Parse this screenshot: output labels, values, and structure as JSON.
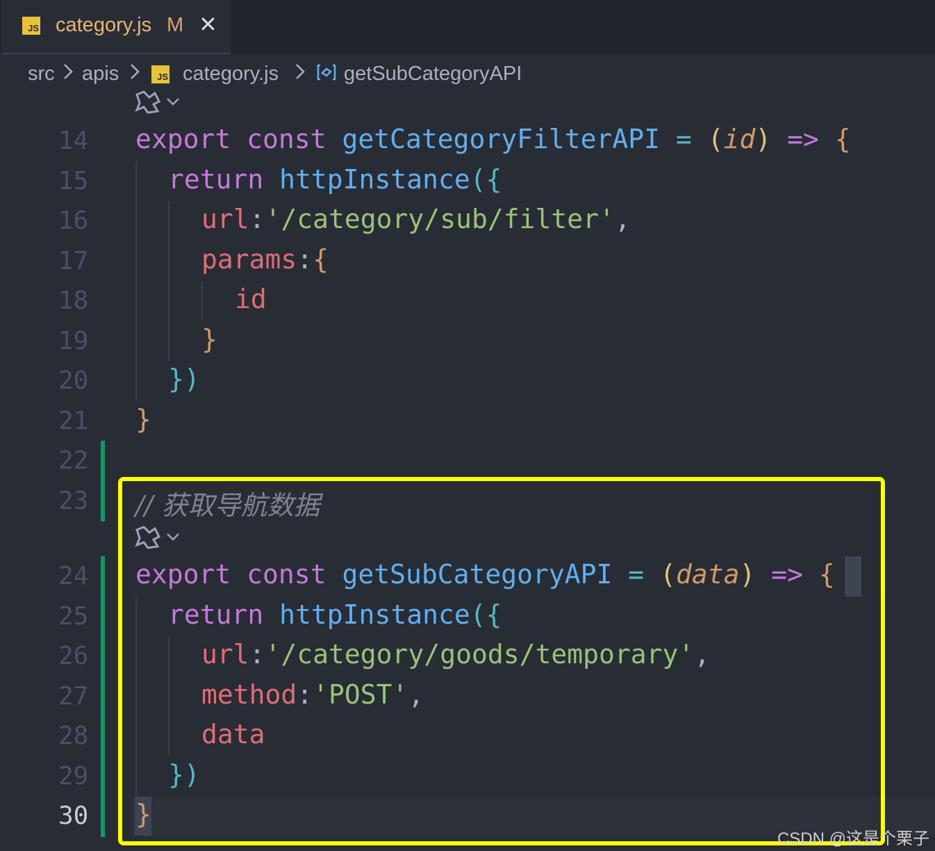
{
  "tab": {
    "icon": "js-file-icon",
    "badge": "JS",
    "filename": "category.js",
    "status": "M",
    "close": "✕"
  },
  "breadcrumb": {
    "items": [
      "src",
      "apis",
      "category.js",
      "getSubCategoryAPI"
    ],
    "badge": "JS"
  },
  "lines": [
    {
      "n": "14"
    },
    {
      "n": "15"
    },
    {
      "n": "16"
    },
    {
      "n": "17"
    },
    {
      "n": "18"
    },
    {
      "n": "19"
    },
    {
      "n": "20"
    },
    {
      "n": "21"
    },
    {
      "n": "22"
    },
    {
      "n": "23"
    },
    {
      "n": "24"
    },
    {
      "n": "25"
    },
    {
      "n": "26"
    },
    {
      "n": "27"
    },
    {
      "n": "28"
    },
    {
      "n": "29"
    },
    {
      "n": "30"
    }
  ],
  "code": {
    "l14": {
      "export": "export",
      "const": "const",
      "name": "getCategoryFilterAPI",
      "eq": "=",
      "lp": "(",
      "param": "id",
      "rp": ")",
      "arrow": "=>",
      "brace": "{"
    },
    "l15": {
      "ret": "return",
      "call": "httpInstance",
      "open": "({"
    },
    "l16": {
      "key": "url",
      "colon": ":",
      "val": "'/category/sub/filter'",
      "comma": ","
    },
    "l17": {
      "key": "params",
      "colon": ":",
      "brace": "{"
    },
    "l18": {
      "key": "id"
    },
    "l19": {
      "brace": "}"
    },
    "l20": {
      "close": "})"
    },
    "l21": {
      "brace": "}"
    },
    "l23": {
      "comment": "// 获取导航数据"
    },
    "l24": {
      "export": "export",
      "const": "const",
      "name": "getSubCategoryAPI",
      "eq": "=",
      "lp": "(",
      "param": "data",
      "rp": ")",
      "arrow": "=>",
      "brace": "{"
    },
    "l25": {
      "ret": "return",
      "call": "httpInstance",
      "open": "({"
    },
    "l26": {
      "key": "url",
      "colon": ":",
      "val": "'/category/goods/temporary'",
      "comma": ","
    },
    "l27": {
      "key": "method",
      "colon": ":",
      "val": "'POST'",
      "comma": ","
    },
    "l28": {
      "key": "data"
    },
    "l29": {
      "close": "})"
    },
    "l30": {
      "brace": "}"
    }
  },
  "watermark": "CSDN @这是个栗子",
  "colors": {
    "highlight_box": "#ffff00",
    "git_added": "#109868",
    "background": "#282c34"
  }
}
